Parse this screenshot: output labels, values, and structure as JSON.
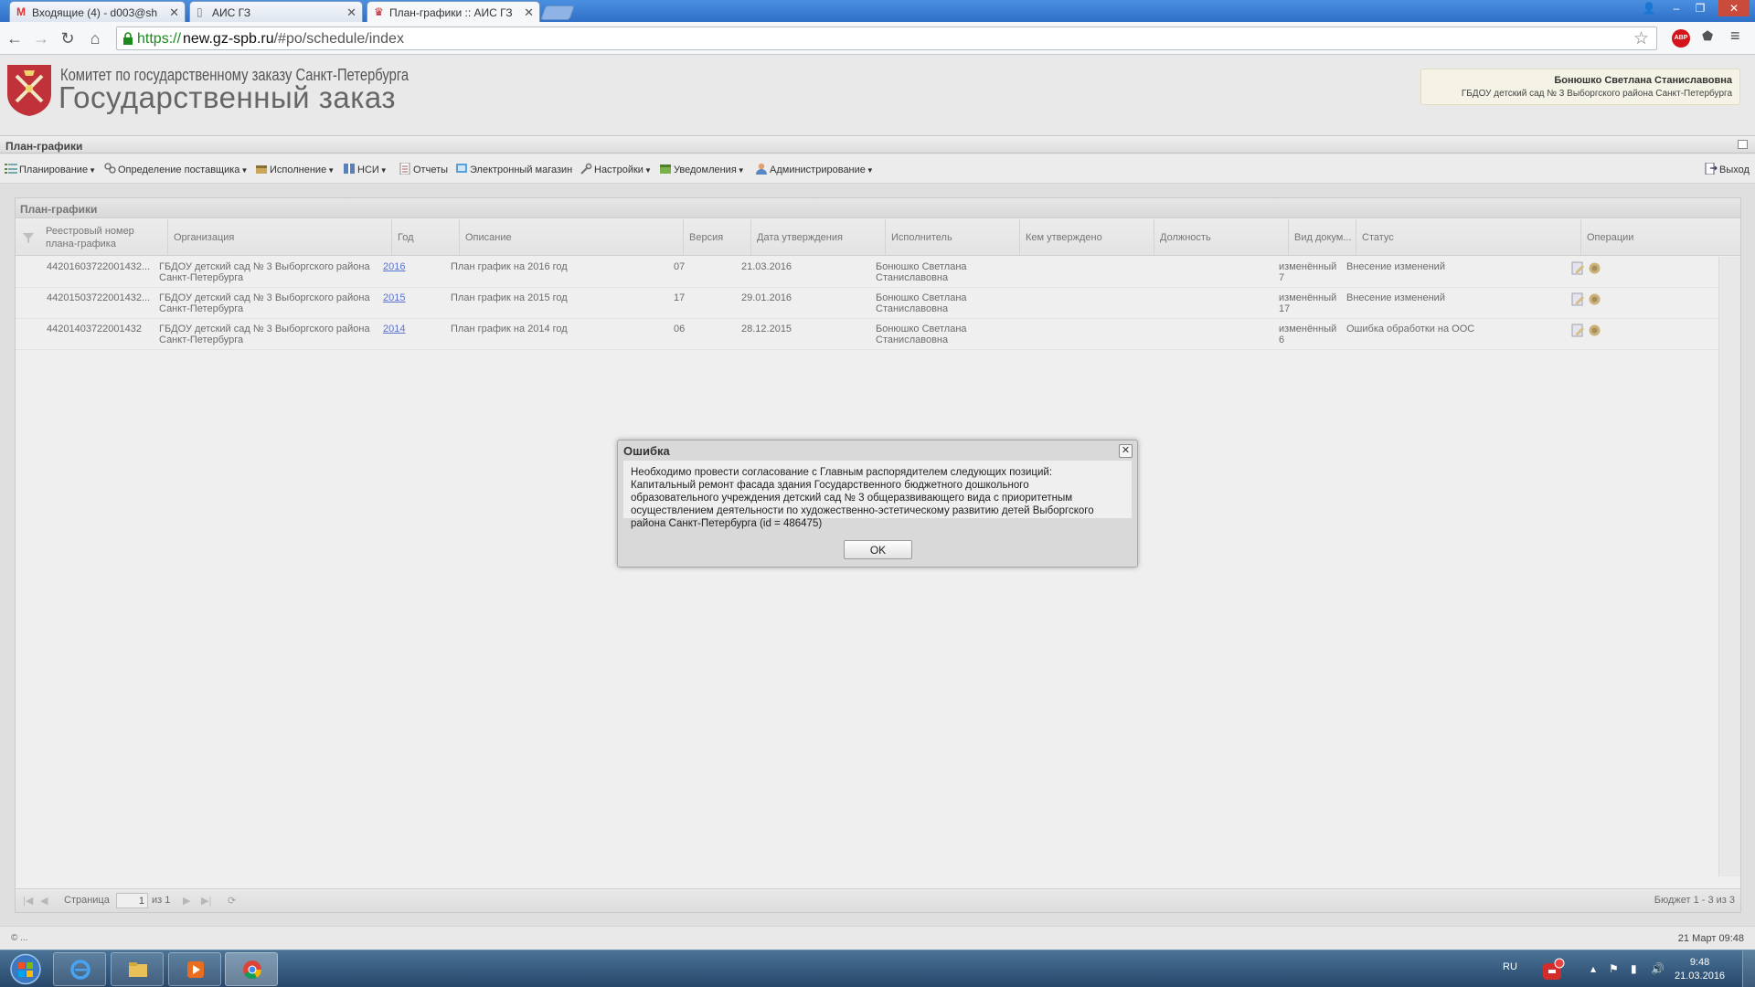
{
  "browser": {
    "tabs": [
      {
        "label": "Входящие (4) - d003@sh",
        "icon": "gmail-icon"
      },
      {
        "label": "АИС ГЗ",
        "icon": "page-icon"
      },
      {
        "label": "План-графики :: АИС ГЗ",
        "icon": "crest-icon",
        "active": true
      }
    ],
    "url_protocol": "https://",
    "url_host": "new.gz-spb.ru",
    "url_path": "/#po/schedule/index",
    "abp_label": "ABP"
  },
  "header": {
    "org_subtitle": "Комитет по государственному заказу Санкт-Петербурга",
    "site_title": "Государственный заказ",
    "user_name": "Бонюшко Светлана Станиславовна",
    "user_org": "ГБДОУ детский сад № 3 Выборгского района Санкт-Петербурга"
  },
  "panel": {
    "title": "План-графики"
  },
  "menu": {
    "items": [
      {
        "label": "Планирование",
        "dropdown": true
      },
      {
        "label": "Определение поставщика",
        "dropdown": true
      },
      {
        "label": "Исполнение",
        "dropdown": true
      },
      {
        "label": "НСИ",
        "dropdown": true
      },
      {
        "label": "Отчеты",
        "dropdown": false
      },
      {
        "label": "Электронный магазин",
        "dropdown": false
      },
      {
        "label": "Настройки",
        "dropdown": true
      },
      {
        "label": "Уведомления",
        "dropdown": true
      },
      {
        "label": "Администрирование",
        "dropdown": true
      }
    ],
    "logout_label": "Выход"
  },
  "grid": {
    "title": "План-графики",
    "columns": [
      "Реестровый номер плана-графика",
      "Организация",
      "Год",
      "Описание",
      "Версия",
      "Дата утверждения",
      "Исполнитель",
      "Кем утверждено",
      "Должность",
      "Вид докум...",
      "Статус",
      "Операции"
    ],
    "rows": [
      {
        "reg_number": "44201603722001432...",
        "org_line1": "ГБДОУ детский сад № 3 Выборгского района",
        "org_line2": "Санкт-Петербурга",
        "year": "2016",
        "description": "План график на 2016 год",
        "version": "07",
        "approved_date": "21.03.2016",
        "executor_line1": "Бонюшко Светлана",
        "executor_line2": "Станиславовна",
        "approved_by": "",
        "position": "",
        "doc_type_line1": "изменённый",
        "doc_type_line2": "7",
        "status": "Внесение изменений"
      },
      {
        "reg_number": "44201503722001432...",
        "org_line1": "ГБДОУ детский сад № 3 Выборгского района",
        "org_line2": "Санкт-Петербурга",
        "year": "2015",
        "description": "План график на 2015 год",
        "version": "17",
        "approved_date": "29.01.2016",
        "executor_line1": "Бонюшко Светлана",
        "executor_line2": "Станиславовна",
        "approved_by": "",
        "position": "",
        "doc_type_line1": "изменённый",
        "doc_type_line2": "17",
        "status": "Внесение изменений"
      },
      {
        "reg_number": "44201403722001432",
        "org_line1": "ГБДОУ детский сад № 3 Выборгского района",
        "org_line2": "Санкт-Петербурга",
        "year": "2014",
        "description": "План график на 2014 год",
        "version": "06",
        "approved_date": "28.12.2015",
        "executor_line1": "Бонюшко Светлана",
        "executor_line2": "Станиславовна",
        "approved_by": "",
        "position": "",
        "doc_type_line1": "изменённый",
        "doc_type_line2": "6",
        "status": "Ошибка обработки на ООС"
      }
    ],
    "pager": {
      "page_label": "Страница",
      "page_value": "1",
      "of_label": "из 1",
      "summary": "Бюджет 1 - 3 из 3"
    }
  },
  "footer": {
    "left": "© ...",
    "right": "21 Март 09:48"
  },
  "modal": {
    "title": "Ошибка",
    "line1": "Необходимо провести согласование с Главным распорядителем следующих позиций:",
    "line2": "Капитальный ремонт фасада здания Государственного бюджетного дошкольного",
    "line3": "образовательного учреждения детский сад № 3 общеразвивающего вида с приоритетным",
    "line4": "осуществлением деятельности по художественно-эстетическому развитию детей Выборгского",
    "line5": "района Санкт-Петербурга (id = 486475)",
    "ok_label": "OK"
  },
  "taskbar": {
    "lang": "RU",
    "time": "9:48",
    "date": "21.03.2016"
  },
  "colors": {
    "titlebar": "#2f6fc7",
    "url_green": "#1a8a1a",
    "link": "#1a3fcc",
    "abp_red": "#d3151b",
    "taskbar": "#27476a"
  }
}
